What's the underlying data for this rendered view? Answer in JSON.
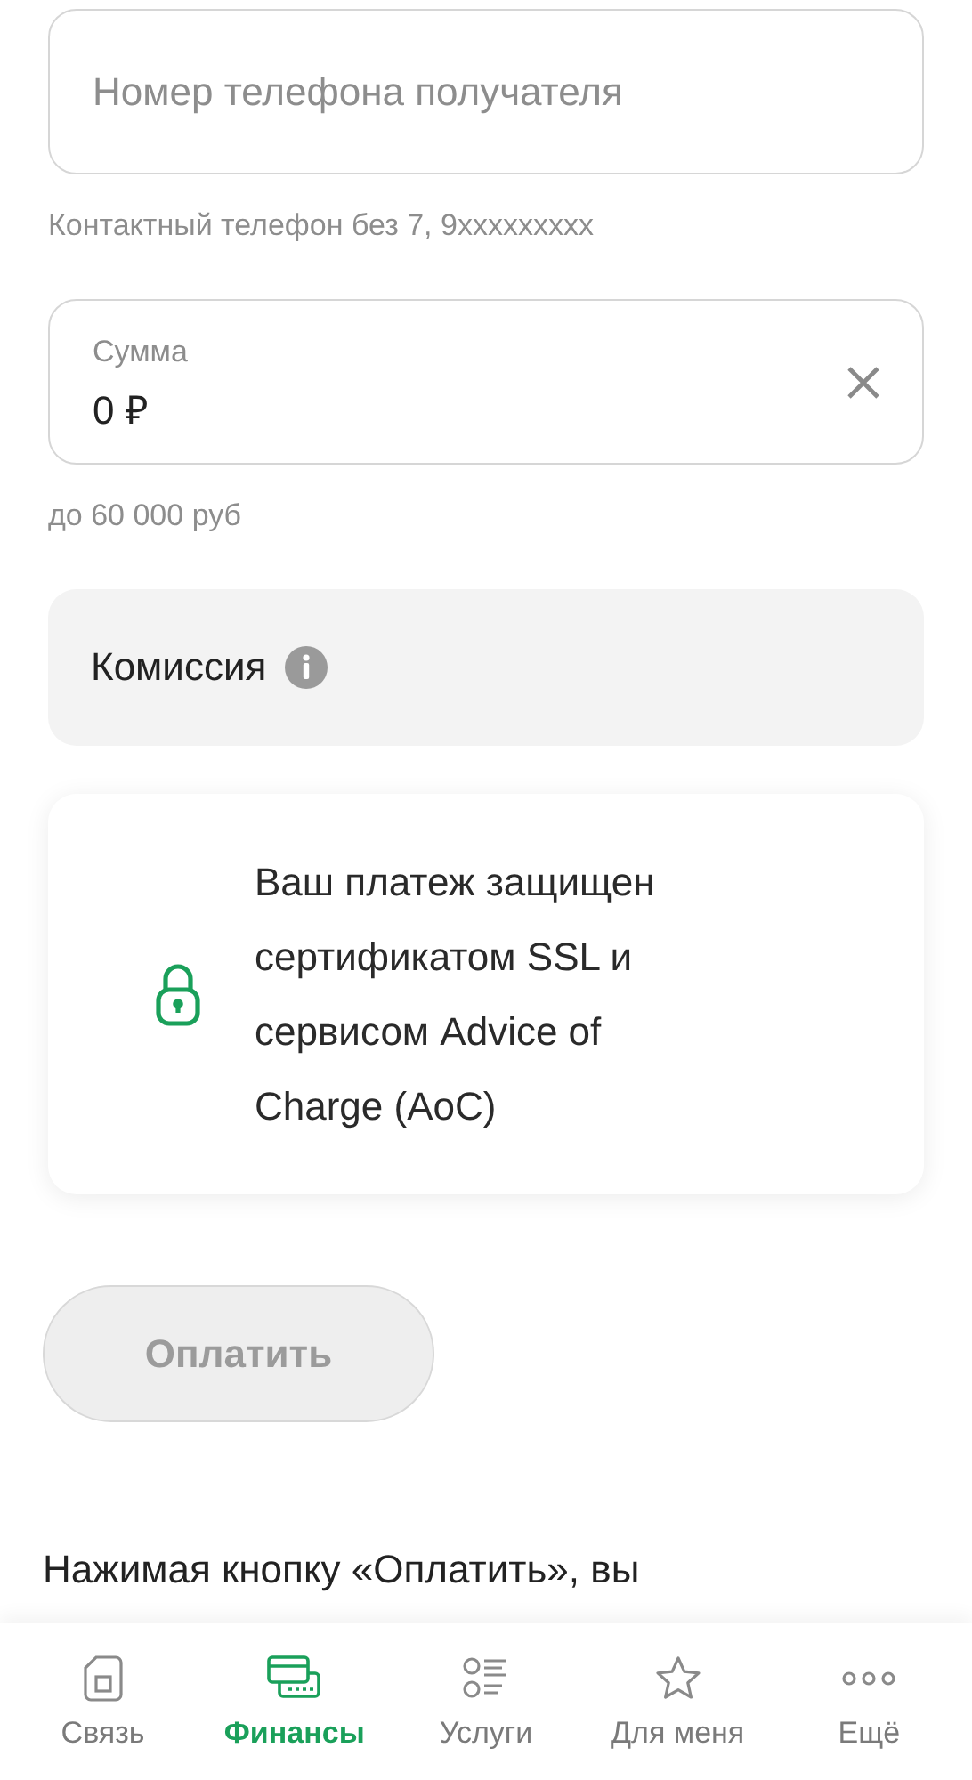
{
  "phone_field": {
    "placeholder": "Номер телефона получателя",
    "hint": "Контактный телефон без 7, 9xxxxxxxxx"
  },
  "amount_field": {
    "label": "Сумма",
    "value": "0 ₽",
    "hint": "до 60 000 руб"
  },
  "commission": {
    "label": "Комиссия"
  },
  "security_note": {
    "text": "Ваш платеж защищен сертификатом SSL и сервисом Advice of Charge (AoC)"
  },
  "pay_button": {
    "label": "Оплатить",
    "disabled": true
  },
  "terms_text": "Нажимая кнопку «Оплатить», вы",
  "bottom_nav": [
    {
      "kind": "sim",
      "label": "Связь",
      "selected": false
    },
    {
      "kind": "cards",
      "label": "Финансы",
      "selected": true
    },
    {
      "kind": "list",
      "label": "Услуги",
      "selected": false
    },
    {
      "kind": "star",
      "label": "Для меня",
      "selected": false
    },
    {
      "kind": "more",
      "label": "Ещё",
      "selected": false
    }
  ]
}
